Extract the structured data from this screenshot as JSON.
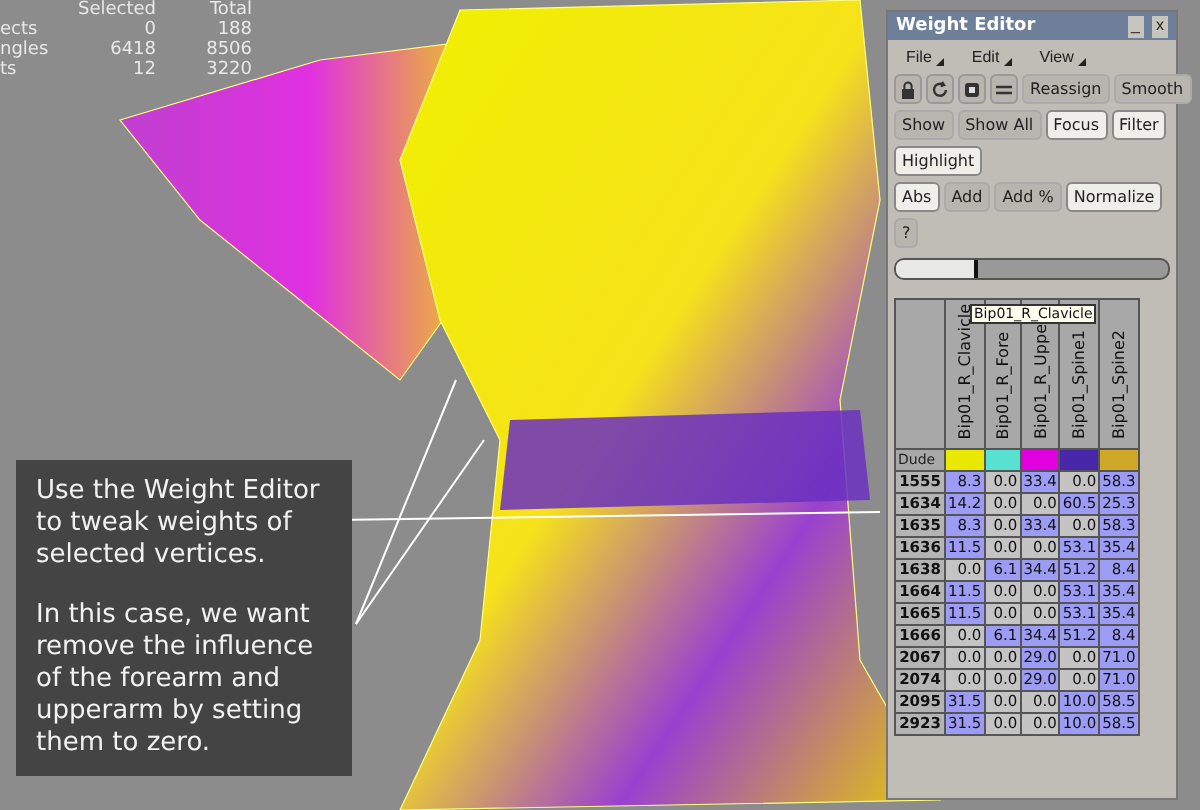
{
  "stats": {
    "columns": [
      "Selected",
      "Total"
    ],
    "rows": [
      {
        "label": "ects",
        "selected": "0",
        "total": "188"
      },
      {
        "label": "ngles",
        "selected": "6418",
        "total": "8506"
      },
      {
        "label": "ts",
        "selected": "12",
        "total": "3220"
      }
    ]
  },
  "callout": {
    "paragraphs": [
      "Use the Weight Editor to tweak weights of selected vertices.",
      "In this case, we want remove the influence of the forearm and upperarm by setting them to zero."
    ]
  },
  "window": {
    "title": "Weight Editor",
    "minimize": "_",
    "close": "x"
  },
  "menu": [
    "File",
    "Edit",
    "View"
  ],
  "toolbar": {
    "actions": [
      "Reassign",
      "Smooth"
    ]
  },
  "option_rows": [
    [
      {
        "label": "Show",
        "on": false
      },
      {
        "label": "Show All",
        "on": false
      },
      {
        "label": "Focus",
        "on": true
      },
      {
        "label": "Filter",
        "on": true
      }
    ],
    [
      {
        "label": "Highlight",
        "on": true
      }
    ],
    [
      {
        "label": "Abs",
        "on": true
      },
      {
        "label": "Add",
        "on": false
      },
      {
        "label": "Add %",
        "on": false
      },
      {
        "label": "Normalize",
        "on": true
      }
    ]
  ],
  "help": "?",
  "slider": {
    "level": 0.3
  },
  "table": {
    "corner": "Dude",
    "columns": [
      {
        "name": "Bip01_R_Clavicle",
        "color": "#e8e800"
      },
      {
        "name": "Bip01_R_Fore",
        "color": "#58e0d0"
      },
      {
        "name": "Bip01_R_Uppe",
        "color": "#e000e0"
      },
      {
        "name": "Bip01_Spine1",
        "color": "#4828a8"
      },
      {
        "name": "Bip01_Spine2",
        "color": "#d0a828"
      }
    ],
    "tooltip": "Bip01_R_Clavicle",
    "rows": [
      {
        "id": "1555",
        "values": [
          "8.3",
          "0.0",
          "33.4",
          "0.0",
          "58.3"
        ],
        "selected": [
          true,
          false,
          true,
          false,
          true
        ]
      },
      {
        "id": "1634",
        "values": [
          "14.2",
          "0.0",
          "0.0",
          "60.5",
          "25.3"
        ],
        "selected": [
          true,
          false,
          false,
          true,
          true
        ]
      },
      {
        "id": "1635",
        "values": [
          "8.3",
          "0.0",
          "33.4",
          "0.0",
          "58.3"
        ],
        "selected": [
          true,
          false,
          true,
          false,
          true
        ]
      },
      {
        "id": "1636",
        "values": [
          "11.5",
          "0.0",
          "0.0",
          "53.1",
          "35.4"
        ],
        "selected": [
          true,
          false,
          false,
          true,
          true
        ]
      },
      {
        "id": "1638",
        "values": [
          "0.0",
          "6.1",
          "34.4",
          "51.2",
          "8.4"
        ],
        "selected": [
          false,
          true,
          true,
          true,
          true
        ]
      },
      {
        "id": "1664",
        "values": [
          "11.5",
          "0.0",
          "0.0",
          "53.1",
          "35.4"
        ],
        "selected": [
          true,
          false,
          false,
          true,
          true
        ]
      },
      {
        "id": "1665",
        "values": [
          "11.5",
          "0.0",
          "0.0",
          "53.1",
          "35.4"
        ],
        "selected": [
          true,
          false,
          false,
          true,
          true
        ]
      },
      {
        "id": "1666",
        "values": [
          "0.0",
          "6.1",
          "34.4",
          "51.2",
          "8.4"
        ],
        "selected": [
          false,
          true,
          true,
          true,
          true
        ]
      },
      {
        "id": "2067",
        "values": [
          "0.0",
          "0.0",
          "29.0",
          "0.0",
          "71.0"
        ],
        "selected": [
          false,
          false,
          true,
          false,
          true
        ]
      },
      {
        "id": "2074",
        "values": [
          "0.0",
          "0.0",
          "29.0",
          "0.0",
          "71.0"
        ],
        "selected": [
          false,
          false,
          true,
          false,
          true
        ]
      },
      {
        "id": "2095",
        "values": [
          "31.5",
          "0.0",
          "0.0",
          "10.0",
          "58.5"
        ],
        "selected": [
          true,
          false,
          false,
          true,
          true
        ]
      },
      {
        "id": "2923",
        "values": [
          "31.5",
          "0.0",
          "0.0",
          "10.0",
          "58.5"
        ],
        "selected": [
          true,
          false,
          false,
          true,
          true
        ]
      }
    ]
  }
}
